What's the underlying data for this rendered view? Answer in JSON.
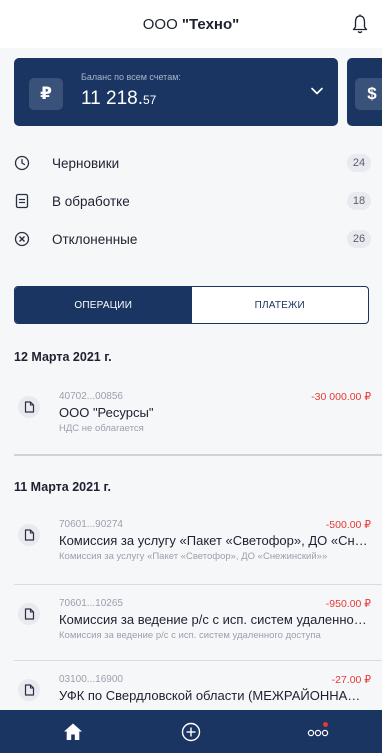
{
  "header": {
    "company_prefix": "ООО ",
    "company_name": "\"Техно\""
  },
  "balance_card": {
    "currency_symbol": "₽",
    "label": "Баланс по всем счетам:",
    "amount_int": "11 218.",
    "amount_frac": "57",
    "next_card_symbol": "$"
  },
  "statuses": [
    {
      "label": "Черновики",
      "count": "24",
      "icon": "clock-icon"
    },
    {
      "label": "В обработке",
      "count": "18",
      "icon": "document-processing-icon"
    },
    {
      "label": "Отклоненные",
      "count": "26",
      "icon": "x-circle-icon"
    }
  ],
  "tabs": {
    "operations": "ОПЕРАЦИИ",
    "payments": "ПЛАТЕЖИ",
    "active": "operations"
  },
  "groups": [
    {
      "date": "12 Марта 2021 г.",
      "items": [
        {
          "account": "40702...00856",
          "amount": "-30 000.00 ₽",
          "name": "ООО \"Ресурсы\"",
          "description": "НДС не облагается"
        }
      ]
    },
    {
      "date": "11 Марта 2021 г.",
      "items": [
        {
          "account": "70601...90274",
          "amount": "-500.00 ₽",
          "name": "Комиссия за услугу «Пакет «Светофор», ДО «Снежинский»",
          "description": "Комиссия за услугу «Пакет «Светофор», ДО «Снежинский»»"
        },
        {
          "account": "70601...10265",
          "amount": "-950.00 ₽",
          "name": "Комиссия за ведение р/с с исп. систем удаленного доступа",
          "description": "Комиссия за ведение р/с с исп. систем удаленного доступа"
        },
        {
          "account": "03100...16900",
          "amount": "-27.00 ₽",
          "name": "УФК по Свердловской области (МЕЖРАЙОННАЯ ИФНС)",
          "description": ""
        }
      ]
    }
  ],
  "nav": {
    "home": "home-icon",
    "add": "plus-circle-icon",
    "more": "more-icon"
  },
  "colors": {
    "primary": "#1b3562",
    "negative_amount": "#e53935",
    "background": "#f6f7f9"
  }
}
